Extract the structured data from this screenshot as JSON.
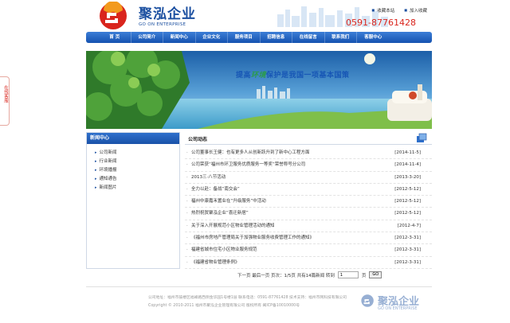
{
  "header": {
    "logo_cn": "聚泓企业",
    "logo_en": "GO ON ENTERPRISE",
    "top_links": [
      "收藏本站",
      "加入收藏"
    ],
    "phone": "0591-87761428"
  },
  "nav": [
    "首 页",
    "公司简介",
    "新闻中心",
    "企业文化",
    "服务项目",
    "招聘信息",
    "在线留言",
    "联系我们",
    "客服中心"
  ],
  "banner": {
    "text_prefix": "提高",
    "text_highlight": "环境",
    "text_suffix": "保护是我国一项基本国策"
  },
  "side_chat": {
    "label": "在线客服"
  },
  "left": {
    "title": "新闻中心",
    "items": [
      "公司新闻",
      "行业新闻",
      "环境播报",
      "通知通告",
      "新闻图片"
    ]
  },
  "right": {
    "title": "公司动态",
    "news": [
      {
        "title": "公司董事长王健：也有更多人从创新跃升到了新中心工程方面",
        "date": "[2014-11-5]"
      },
      {
        "title": "公司荣获“福州市环卫服务优质服务一等奖”荣誉称号分公司",
        "date": "[2014-11-4]"
      },
      {
        "title": "2013三·八节活动",
        "date": "[2013-3-20]"
      },
      {
        "title": "全力以赴：备战“南交会”",
        "date": "[2012-5-12]"
      },
      {
        "title": "福州中康嘉禾置业在“升级服务”中活动",
        "date": "[2012-5-12]"
      },
      {
        "title": "热烈祝贺聚泓企业“喜迁新居”",
        "date": "[2012-5-12]"
      },
      {
        "title": "关于深入开展规范小区物业管理活动的通知",
        "date": "[2012-4-7]"
      },
      {
        "title": "《福州市房地产管理局关于加强物业服务收费管理工作的通知》",
        "date": "[2012-3-31]"
      },
      {
        "title": "福建省城市住宅小区物业服务规范",
        "date": "[2012-3-31]"
      },
      {
        "title": "《福建省物业管理条例》",
        "date": "[2012-3-31]"
      }
    ],
    "pager": {
      "text": "下一页  最后一页  页次：1/5页  共有14篇新闻  转到",
      "input_value": "1",
      "unit": "页",
      "go_label": "GO"
    }
  },
  "footer": {
    "line1": "公司地址：福州市鼓楼区福峰路西侧金华园1号楼1层   联系电话：0591-87761428   技术支持：福州市网科技有限公司",
    "line2": "Copyright © 2010-2011 福州市聚泓企业管理有限公司 版权所有 闽ICP备10010000号",
    "logo_cn": "聚泓企业",
    "logo_en": "GO ON ENTERPRISE"
  },
  "colors": {
    "brand_blue": "#1b4fa0",
    "phone_red": "#d9251d"
  }
}
